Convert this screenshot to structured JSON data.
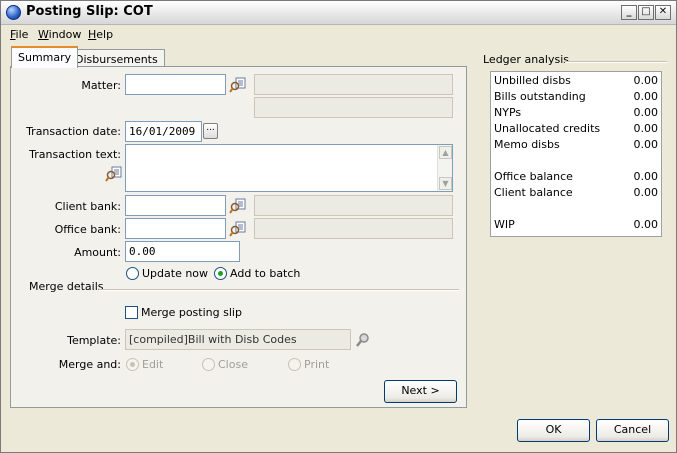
{
  "window": {
    "title": "Posting Slip: COT"
  },
  "menu": [
    {
      "first": "F",
      "rest": "ile"
    },
    {
      "first": "W",
      "rest": "indow"
    },
    {
      "first": "H",
      "rest": "elp"
    }
  ],
  "tabs": {
    "summary": "Summary",
    "disbursements": "Disbursements"
  },
  "form": {
    "matter_label": "Matter:",
    "matter_value": "",
    "date_label": "Transaction date:",
    "date_value": "16/01/2009",
    "date_button": "...",
    "text_label": "Transaction text:",
    "client_bank_label": "Client bank:",
    "office_bank_label": "Office bank:",
    "amount_label": "Amount:",
    "amount_value": "0.00",
    "update_now": "Update now",
    "add_to_batch": "Add to batch",
    "selected_option": "Add to batch"
  },
  "merge": {
    "section_label": "Merge details",
    "merge_posting_slip": "Merge posting slip",
    "merge_checked": false,
    "template_label": "Template:",
    "template_value": "[compiled]Bill with Disb Codes",
    "merge_and_label": "Merge and:",
    "edit": "Edit",
    "close": "Close",
    "print": "Print",
    "next_button": "Next >"
  },
  "ledger": {
    "title": "Ledger analysis",
    "rows": [
      {
        "label": "Unbilled disbs",
        "value": "0.00"
      },
      {
        "label": "Bills outstanding",
        "value": "0.00"
      },
      {
        "label": "NYPs",
        "value": "0.00"
      },
      {
        "label": "Unallocated credits",
        "value": "0.00"
      },
      {
        "label": "Memo disbs",
        "value": "0.00"
      },
      {
        "label": "Office balance",
        "value": "0.00"
      },
      {
        "label": "Client balance",
        "value": "0.00"
      },
      {
        "label": "WIP",
        "value": "0.00"
      }
    ]
  },
  "buttons": {
    "ok": "OK",
    "cancel": "Cancel"
  },
  "colors": {
    "tab_accent": "#e68b2c",
    "radio_dot": "#21a121",
    "input_border": "#7f9db9"
  }
}
